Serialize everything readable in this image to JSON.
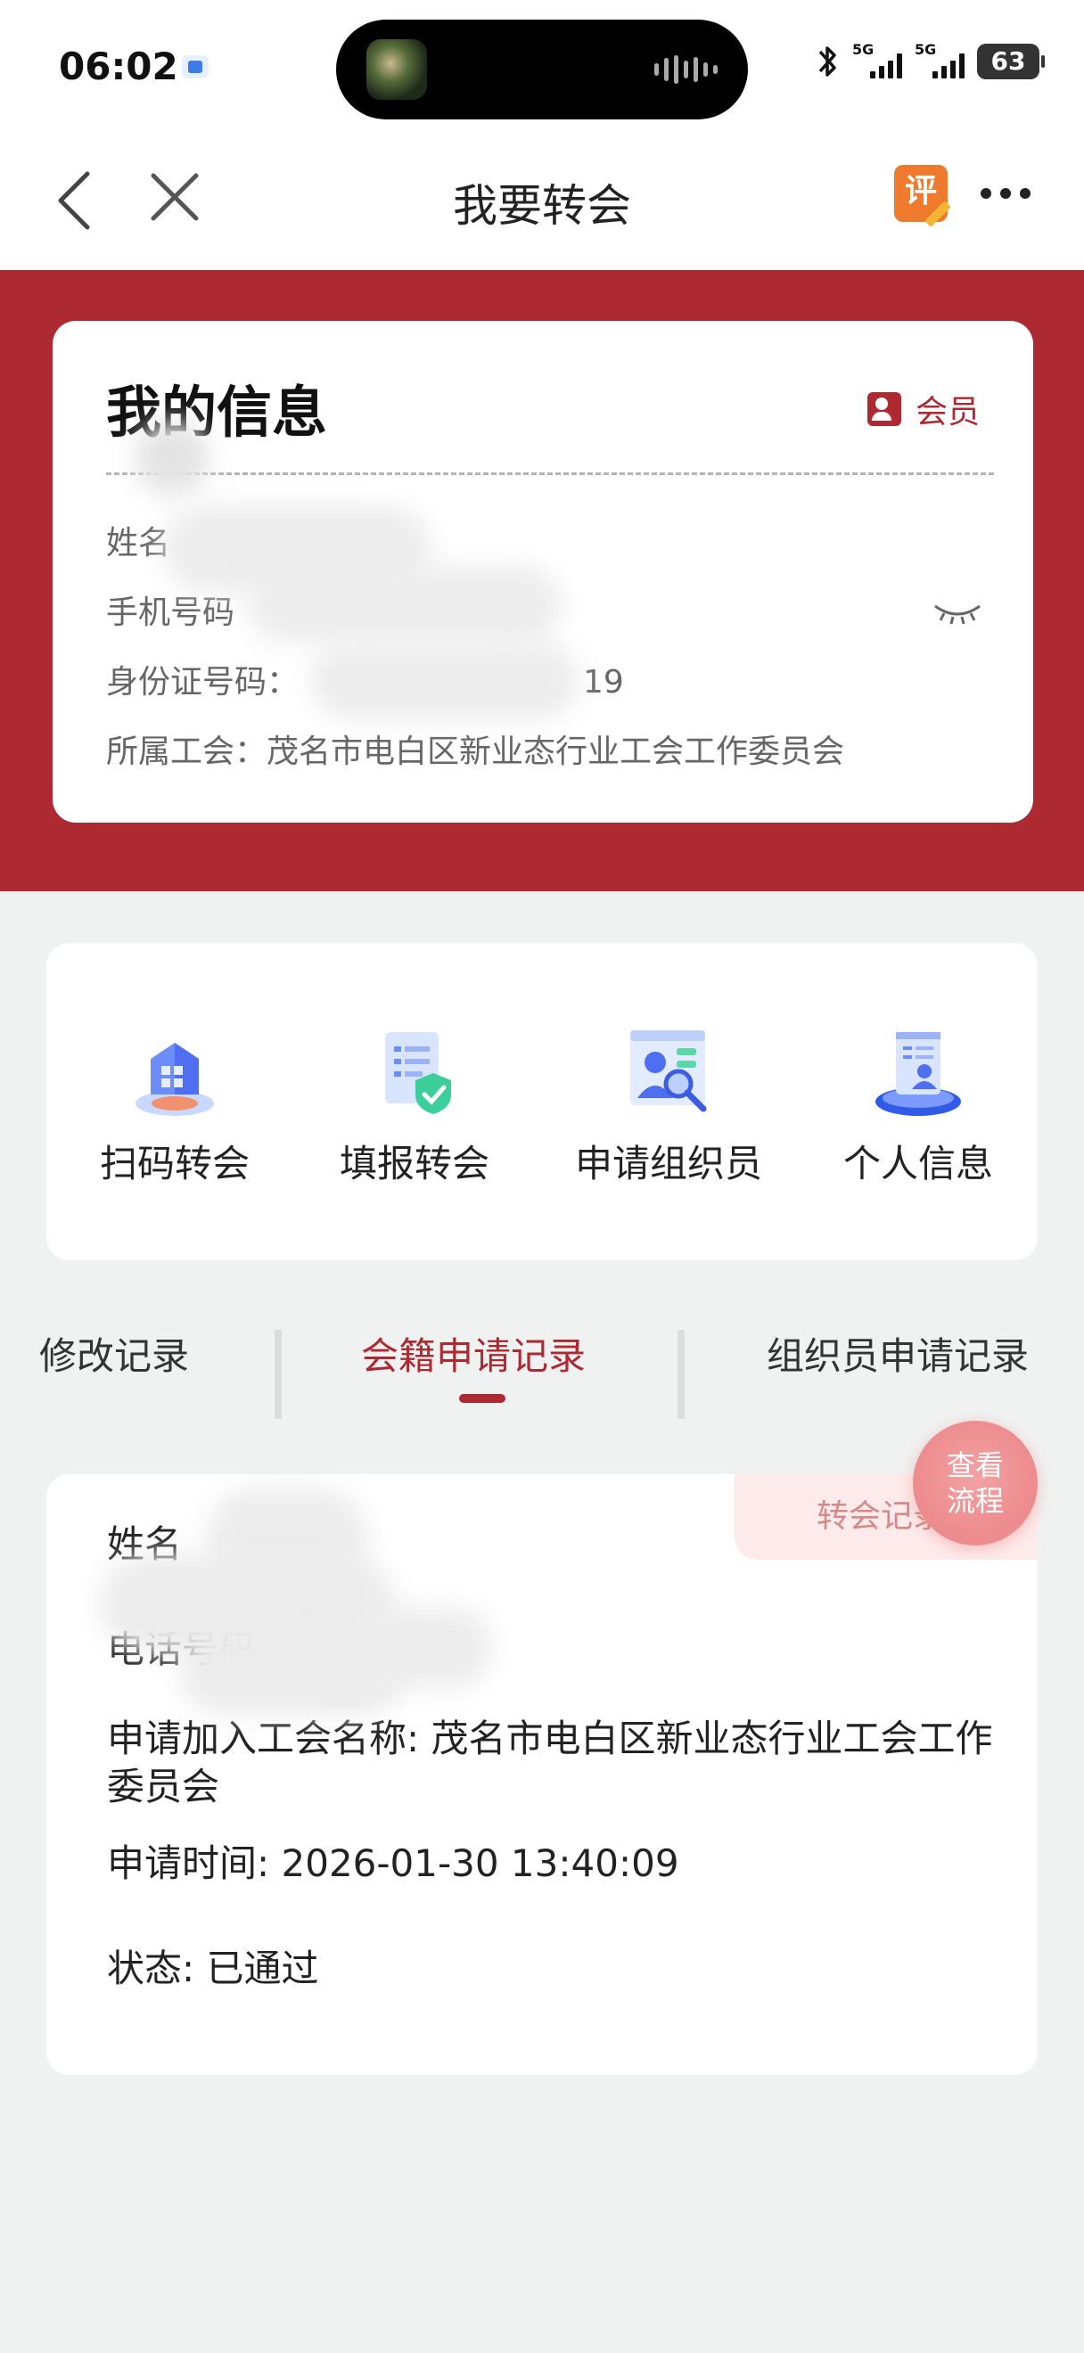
{
  "status_bar": {
    "time": "06:02",
    "network_1": "5G",
    "network_2": "5G",
    "battery": "63"
  },
  "nav": {
    "title": "我要转会",
    "rate_badge": "评"
  },
  "info_card": {
    "title": "我的信息",
    "member_label": "会员",
    "rows": {
      "name_label": "姓名",
      "phone_label": "手机号码",
      "id_label": "身份证号码：",
      "id_tail": "19",
      "union_label": "所属工会：",
      "union_value": "茂名市电白区新业态行业工会工作委员会"
    }
  },
  "actions": [
    {
      "label": "扫码转会",
      "icon": "qr-building-icon"
    },
    {
      "label": "填报转会",
      "icon": "form-shield-icon"
    },
    {
      "label": "申请组织员",
      "icon": "person-search-icon"
    },
    {
      "label": "个人信息",
      "icon": "profile-card-icon"
    }
  ],
  "tabs": {
    "items": [
      "修改记录",
      "会籍申请记录",
      "组织员申请记录"
    ],
    "active": "会籍申请记录"
  },
  "record": {
    "tag": "转会记录",
    "name_label": "姓名",
    "phone_label": "电话号码",
    "phone_masked": "****",
    "union_line": "申请加入工会名称: 茂名市电白区新业态行业工会工作委员会",
    "time_line": "申请时间: 2026-01-30 13:40:09",
    "status_line": "状态: 已通过"
  },
  "fab": {
    "label_line1": "查看",
    "label_line2": "流程"
  },
  "colors": {
    "brand_red": "#ad2a33",
    "page_bg": "#f0f1f1"
  }
}
